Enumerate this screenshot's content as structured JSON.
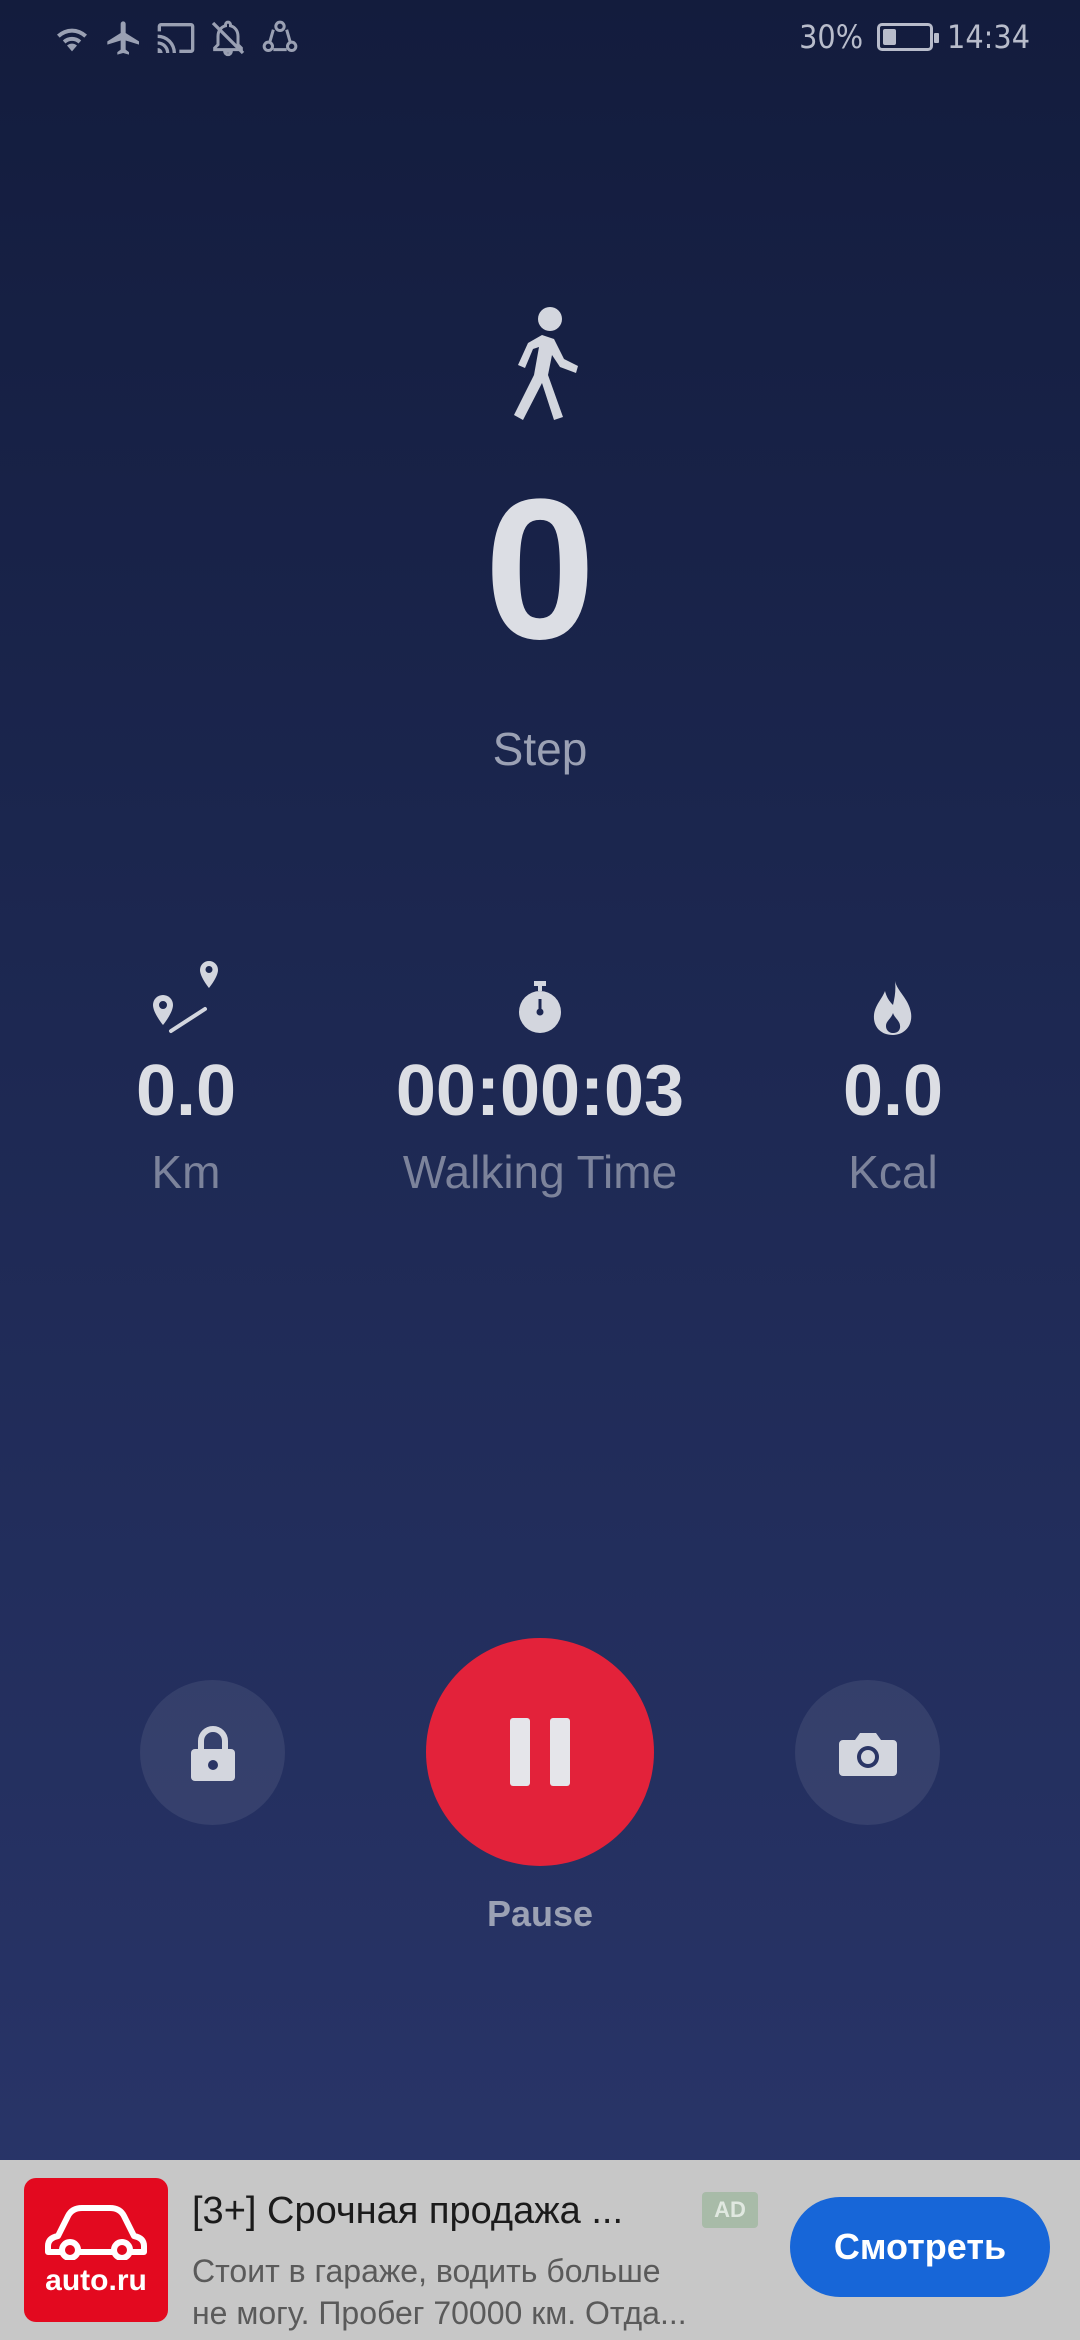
{
  "status_bar": {
    "battery_percent": "30%",
    "battery_level": 0.3,
    "time": "14:34",
    "icons": [
      "wifi-icon",
      "airplane-icon",
      "cast-icon",
      "bell-off-icon",
      "sync-icon"
    ]
  },
  "main": {
    "step_value": "0",
    "step_label": "Step"
  },
  "stats": {
    "distance": {
      "value": "0.0",
      "label": "Km",
      "icon": "route-icon"
    },
    "time": {
      "value": "00:00:03",
      "label": "Walking Time",
      "icon": "stopwatch-icon"
    },
    "calories": {
      "value": "0.0",
      "label": "Kcal",
      "icon": "flame-icon"
    }
  },
  "controls": {
    "pause_label": "Pause",
    "lock_icon": "lock-icon",
    "camera_icon": "camera-icon"
  },
  "ad": {
    "logo_text": "auto.ru",
    "title": "[3+] Срочная продажа ...",
    "badge": "AD",
    "desc_line1": "Стоит в гараже, водить больше",
    "desc_line2": "не могу. Пробег 70000 км. Отда...",
    "button": "Смотреть"
  },
  "colors": {
    "accent_red": "#e3223a",
    "ad_button_blue": "#1766d8",
    "background_top": "#131c3d",
    "background_bottom": "#2a366b"
  }
}
